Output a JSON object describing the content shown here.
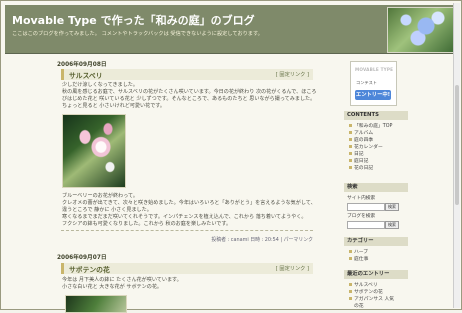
{
  "header": {
    "title": "Movable Type で作った「和みの庭」のブログ",
    "description": "ここはこのブログを作ってみました。\nコメントやトラックバックは 受信できないように設定しております。"
  },
  "posts": [
    {
      "date": "2006年09月08日",
      "title": "サルスベリ",
      "permalink": "[ 固定リンク ]",
      "lines": [
        "少しだけ涼しくなってきました。",
        "秋の風を感じるお庭で、サルスベリの花がたくさん咲いています。今日の花が終わり 次の花がくるんで、ほころ",
        "びはじめた花と 咲いている花と 少しずつです。そんなところで、あるものたちと 思いながら撮ってみました。",
        "ちょっと見ると 小さいけれど可愛い花です。"
      ],
      "caption_lines": [
        "ブルーベリーのお花が終わって。",
        "クレオメの蕾が出てきて、次々と咲き始めました。今年はいろいろと「ありがとう」を言えるような気がして、",
        "違うところで 静かに 小さく見ました。",
        "寒くなるまでまだまだ咲いてくれそうです。インパチェンスを植え込んで、これから 落ち着いてようやく。",
        "フクシアの鉢も可愛くなりました。これから 秋のお庭を楽しみたいです。"
      ],
      "meta": "投稿者 : canami 日時 : 20:54 | パーマリンク"
    },
    {
      "date": "2006年09月07日",
      "title": "サボテンの花",
      "permalink": "[ 固定リンク ]",
      "lines": [
        "今年は 月下美人の鉢に たくさん花が咲いています。",
        "小さな白い花と 大きな花が サボテンの花。"
      ]
    }
  ],
  "sidebar": {
    "ad": {
      "brand": "MOVABLE TYPE",
      "contest": "コンテスト",
      "entry": "エントリー中!"
    },
    "contents_title": "CONTENTS",
    "contents": [
      "「和みの庭」TOP",
      "アルバム",
      "庭の四季",
      "花カレンダー",
      "日記",
      "庭日記",
      "花の日記"
    ],
    "search_title": "検索",
    "search_labels": [
      "サイト内検索",
      "ブログを検索"
    ],
    "search_button": "検索",
    "categories_title": "カテゴリー",
    "categories": [
      "ハーブ",
      "庭仕事"
    ],
    "recent_title": "最近のエントリー",
    "recent": [
      "サルスベリ",
      "サボテンの花",
      "アガパンサス 人気",
      "の花"
    ]
  }
}
